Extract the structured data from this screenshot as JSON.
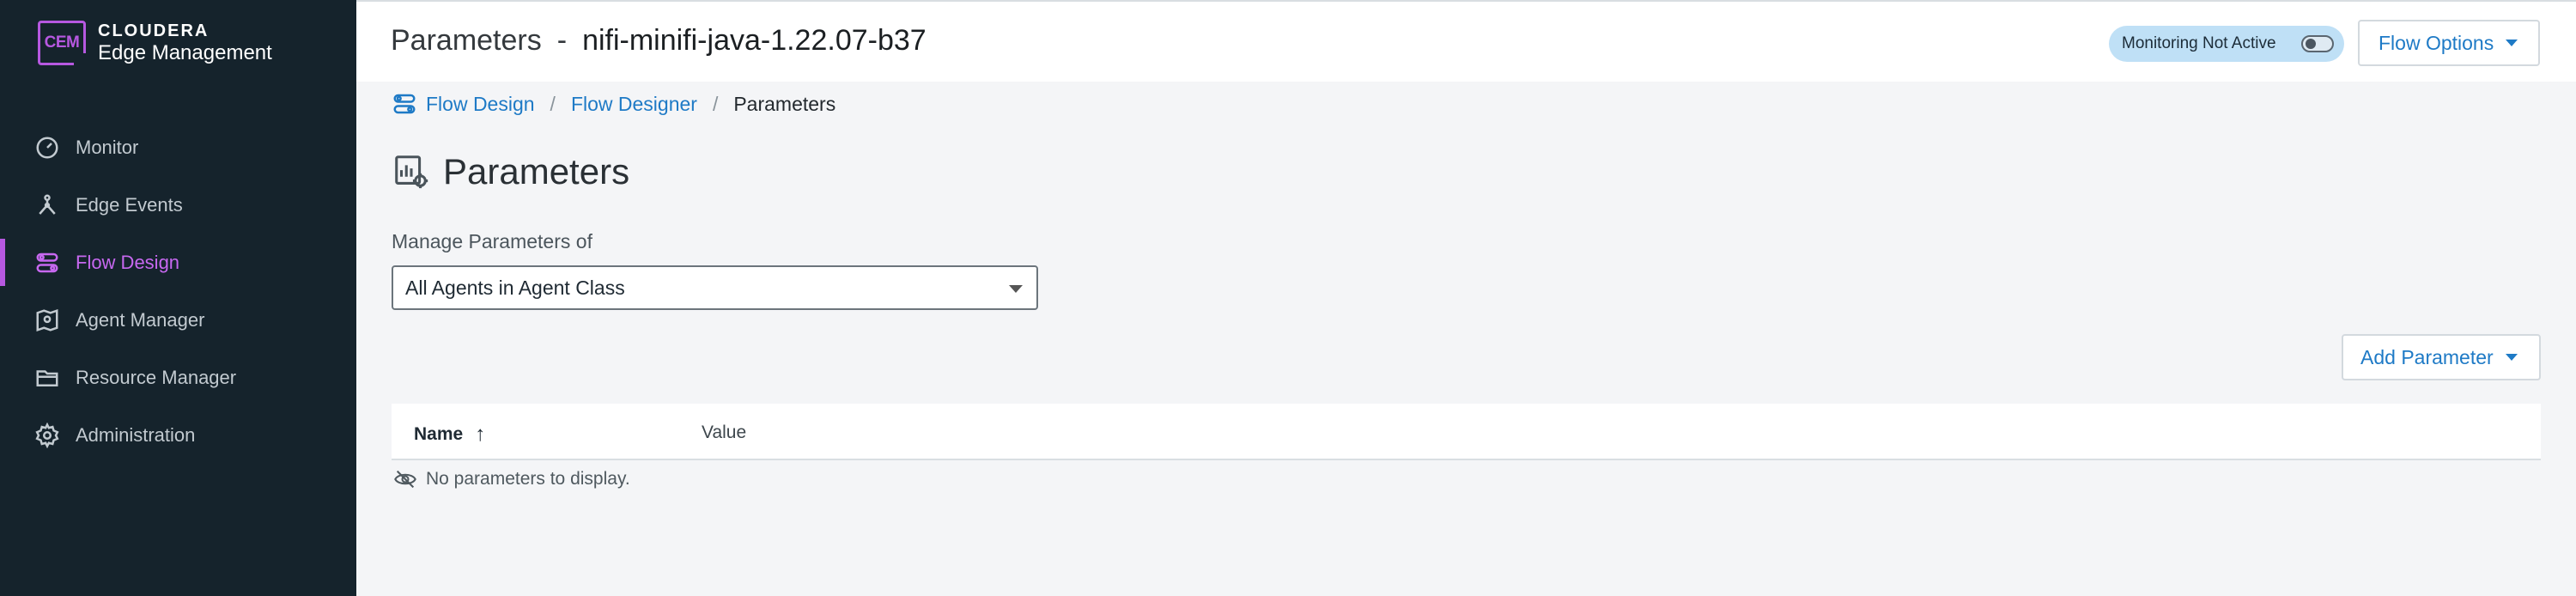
{
  "brand": {
    "mark": "CEM",
    "name_top": "CLOUDERA",
    "name_bottom": "Edge Management"
  },
  "sidebar": {
    "items": [
      {
        "label": "Monitor",
        "icon": "gauge-icon"
      },
      {
        "label": "Edge Events",
        "icon": "network-node-icon"
      },
      {
        "label": "Flow Design",
        "icon": "flow-design-icon",
        "active": true
      },
      {
        "label": "Agent Manager",
        "icon": "agent-map-icon"
      },
      {
        "label": "Resource Manager",
        "icon": "folder-icon"
      },
      {
        "label": "Administration",
        "icon": "gear-icon"
      }
    ]
  },
  "header": {
    "title": "Parameters",
    "separator": "-",
    "flow_name": "nifi-minifi-java-1.22.07-b37",
    "monitoring_badge": "Monitoring Not Active",
    "flow_options_label": "Flow Options"
  },
  "breadcrumb": {
    "items": [
      "Flow Design",
      "Flow Designer"
    ],
    "current": "Parameters",
    "separator": "/"
  },
  "section": {
    "title": "Parameters"
  },
  "manage": {
    "label": "Manage Parameters of",
    "selected": "All Agents in Agent Class"
  },
  "actions": {
    "add_parameter_label": "Add Parameter"
  },
  "table": {
    "columns": [
      "Name",
      "Value"
    ],
    "sort_indicator": "↑",
    "empty_message": "No parameters to display."
  },
  "colors": {
    "sidebar_bg": "#15232c",
    "accent_purple": "#b658e0",
    "link_blue": "#1e7ac6",
    "badge_bg": "#bfe0f6"
  }
}
